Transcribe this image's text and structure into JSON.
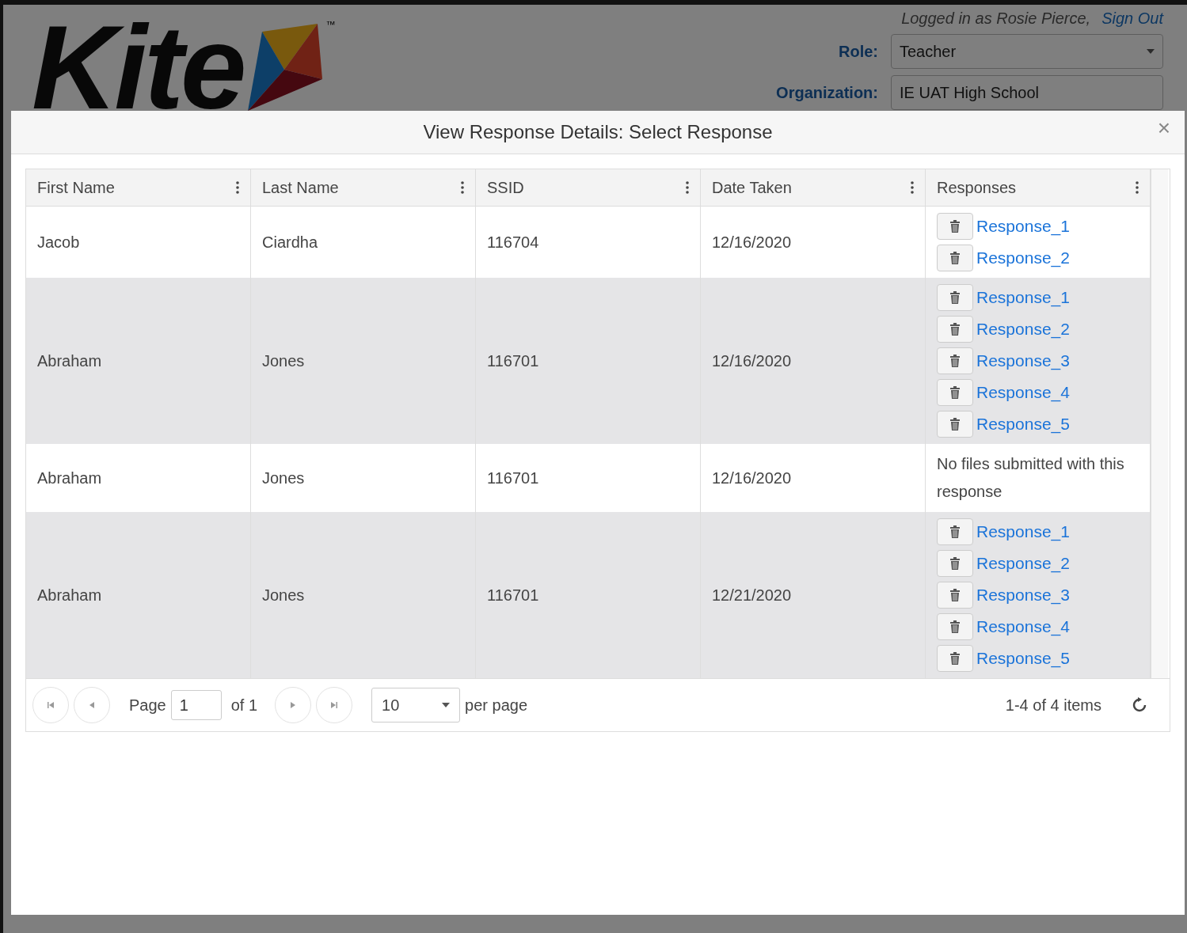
{
  "header": {
    "logo_text": "Kite",
    "trademark": "™",
    "logged_in": "Logged in as Rosie Pierce,",
    "sign_out": "Sign Out",
    "role_label": "Role:",
    "role_value": "Teacher",
    "organization_label": "Organization:",
    "organization_value": "IE UAT High School"
  },
  "modal": {
    "title": "View Response Details: Select Response",
    "close": "×",
    "columns": [
      "First Name",
      "Last Name",
      "SSID",
      "Date Taken",
      "Responses"
    ],
    "rows": [
      {
        "first_name": "Jacob",
        "last_name": "Ciardha",
        "ssid": "116704",
        "date_taken": "12/16/2020",
        "responses": {
          "kind": "files",
          "files": [
            "Response_1",
            "Response_2"
          ]
        }
      },
      {
        "first_name": "Abraham",
        "last_name": "Jones",
        "ssid": "116701",
        "date_taken": "12/16/2020",
        "responses": {
          "kind": "files",
          "files": [
            "Response_1",
            "Response_2",
            "Response_3",
            "Response_4",
            "Response_5"
          ]
        }
      },
      {
        "first_name": "Abraham",
        "last_name": "Jones",
        "ssid": "116701",
        "date_taken": "12/16/2020",
        "responses": {
          "kind": "note",
          "text": "No files submitted with this response"
        }
      },
      {
        "first_name": "Abraham",
        "last_name": "Jones",
        "ssid": "116701",
        "date_taken": "12/21/2020",
        "responses": {
          "kind": "files",
          "files": [
            "Response_1",
            "Response_2",
            "Response_3",
            "Response_4",
            "Response_5"
          ]
        }
      }
    ],
    "pager": {
      "page_label": "Page",
      "page_value": "1",
      "of": "of 1",
      "page_size": "10",
      "per_page": "per page",
      "summary": "1-4 of 4 items"
    }
  }
}
